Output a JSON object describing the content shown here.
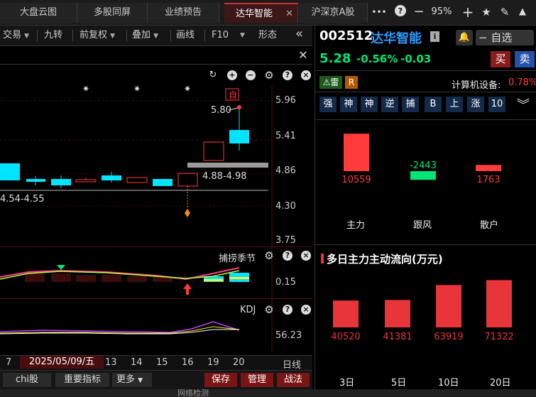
{
  "tabs": [
    {
      "label": "大盘云图"
    },
    {
      "label": "多股同屏"
    },
    {
      "label": "业绩预告"
    },
    {
      "label": "达华智能",
      "active": true
    },
    {
      "label": "沪深京A股"
    }
  ],
  "top_icons": {
    "more": "•••",
    "zoom": "95%"
  },
  "toolbar": {
    "trade": "交易",
    "nine": "九转",
    "restore": "前复权",
    "overlay": "叠加",
    "draw": "画线",
    "f10": "F10",
    "shape": "形态"
  },
  "chart": {
    "price_labels": [
      "5.96",
      "5.41",
      "4.86",
      "4.30",
      "3.75"
    ],
    "annotation_high": "5.80",
    "annotation_range": "4.88-4.98",
    "annotation_left": "4.54-4.55",
    "self_tag": "自",
    "indicator1_name": "捕捞季节",
    "indicator1_value": "0.15",
    "indicator2_name": "KDJ",
    "indicator2_value": "56.23",
    "date_labels": [
      "7",
      "2025/05/09/五",
      "13",
      "14",
      "15",
      "16",
      "19",
      "20"
    ],
    "period": "日线"
  },
  "bottom": {
    "chi": "chi股",
    "indicators": "重要指标",
    "more": "更多",
    "save": "保存",
    "manage": "管理",
    "tactic": "战法"
  },
  "status_bar": "网络检测",
  "stock": {
    "code": "002512",
    "name": "达华智能",
    "price": "5.28",
    "change_pct": "-0.56%",
    "change": "-0.03",
    "self_select": "自选",
    "buy": "买",
    "sell": "卖",
    "thunder": "雷",
    "r_badge": "R",
    "sector": "计算机设备:",
    "sector_pct": "0.78%",
    "quick_buttons": [
      "强",
      "神",
      "神",
      "逆",
      "捕",
      "B",
      "上",
      "涨",
      "10"
    ]
  },
  "flow": {
    "categories": [
      "主力",
      "跟风",
      "散户"
    ],
    "values": [
      10559,
      -2443,
      1763
    ],
    "value_labels": [
      "10559",
      "-2443",
      "1763"
    ]
  },
  "chart_data": {
    "type": "bar",
    "title": "多日主力主动流向(万元)",
    "categories": [
      "3日",
      "5日",
      "10日",
      "20日"
    ],
    "values": [
      40520,
      41381,
      63919,
      71322
    ],
    "value_labels": [
      "40520",
      "41381",
      "63919",
      "71322"
    ],
    "color": "#e8353a"
  },
  "colors": {
    "up": "#ff3b3b",
    "down": "#00e676",
    "cyan": "#00e5ff",
    "accent": "#2979ff"
  }
}
